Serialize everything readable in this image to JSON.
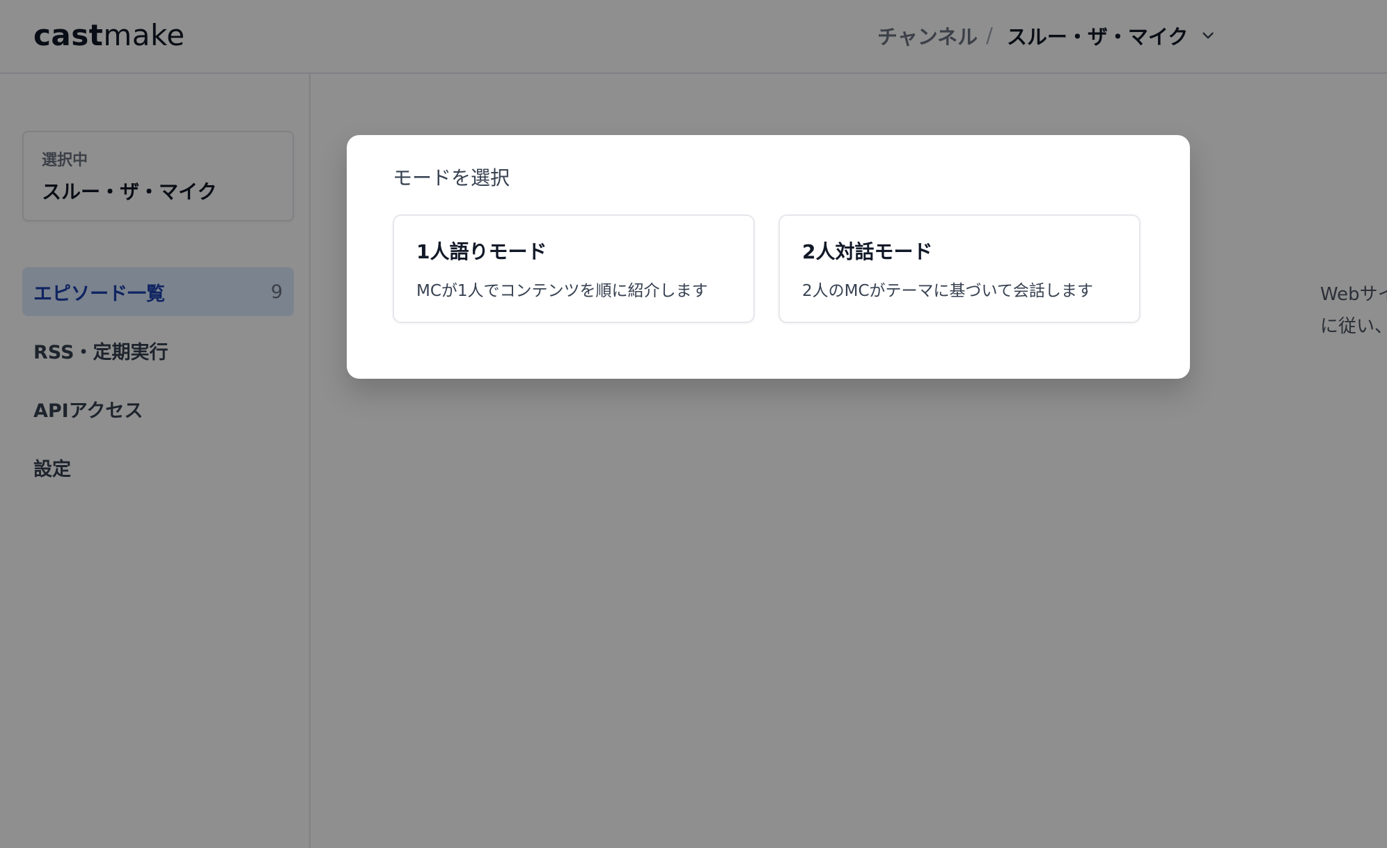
{
  "header": {
    "logo_bold": "cast",
    "logo_light": "make",
    "breadcrumb_label": "チャンネル",
    "breadcrumb_separator": "/",
    "breadcrumb_current": "スルー・ザ・マイク"
  },
  "sidebar": {
    "selected_caption": "選択中",
    "selected_name": "スルー・ザ・マイク",
    "items": [
      {
        "label": "エピソード一覧",
        "count": "9",
        "active": true
      },
      {
        "label": "RSS・定期実行",
        "count": "",
        "active": false
      },
      {
        "label": "APIアクセス",
        "count": "",
        "active": false
      },
      {
        "label": "設定",
        "count": "",
        "active": false
      }
    ]
  },
  "right_panel": {
    "line1": "Webサイ",
    "line2": "に従い、"
  },
  "modal": {
    "title": "モードを選択",
    "options": [
      {
        "title": "1人語りモード",
        "description": "MCが1人でコンテンツを順に紹介します"
      },
      {
        "title": "2人対話モード",
        "description": "2人のMCがテーマに基づいて会話します"
      }
    ]
  },
  "colors": {
    "overlay": "#000000",
    "active_nav_bg": "#dbeafe",
    "active_nav_text": "#1e40af"
  },
  "icons": {
    "breadcrumb_dropdown": "chevron-down-icon"
  }
}
